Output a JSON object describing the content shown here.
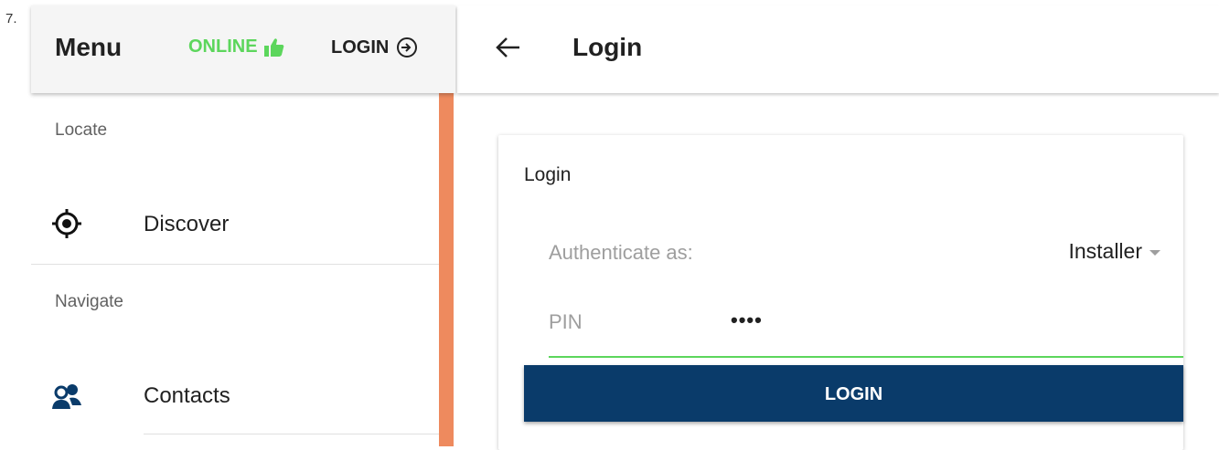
{
  "step": {
    "number": "7."
  },
  "menu": {
    "title": "Menu",
    "status": {
      "label": "ONLINE",
      "color": "#5cd65c",
      "icon": "thumbs-up-icon"
    },
    "login": {
      "label": "LOGIN",
      "icon": "login-arrow-icon"
    },
    "sections": [
      {
        "label": "Locate",
        "items": [
          {
            "label": "Discover",
            "icon": "crosshair-target-icon"
          }
        ]
      },
      {
        "label": "Navigate",
        "items": [
          {
            "label": "Contacts",
            "icon": "contacts-people-icon"
          }
        ]
      }
    ],
    "scrollbar_color": "#ee8a5e"
  },
  "header": {
    "title": "Login",
    "back_icon": "back-arrow-icon"
  },
  "card": {
    "title": "Login",
    "authenticate_label": "Authenticate as:",
    "authenticate_value": "Installer",
    "pin_label": "PIN",
    "pin_value": "••••",
    "button_label": "LOGIN",
    "button_color": "#0a3b6a"
  }
}
